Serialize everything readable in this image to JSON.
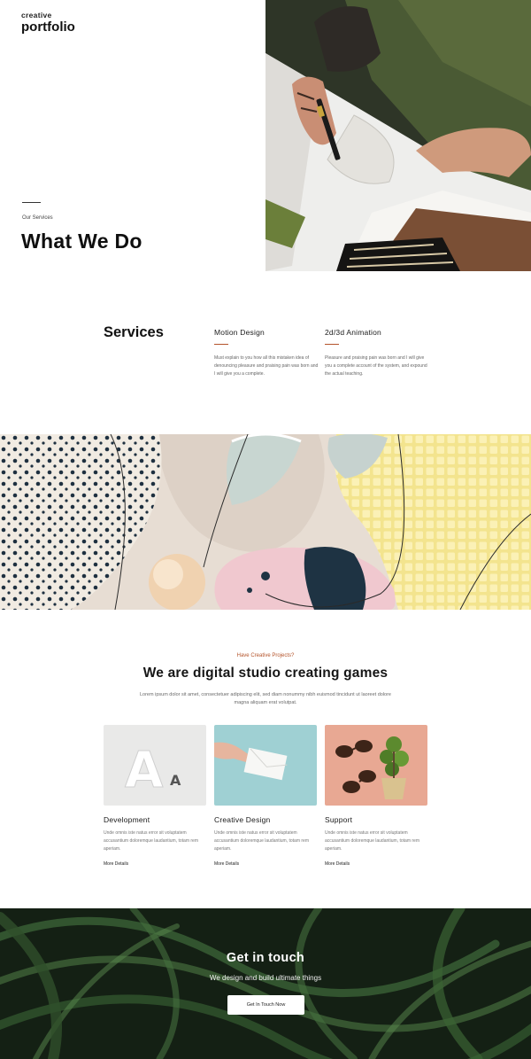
{
  "brand": {
    "top": "creative",
    "bottom": "portfolio"
  },
  "hero": {
    "eyebrow": "Our Services",
    "title": "What We Do",
    "image_icon": "designer-sketching-photo"
  },
  "services": {
    "title": "Services",
    "items": [
      {
        "name": "Motion Design",
        "text": "Must explain to you how all this mistaken idea of denouncing pleasure and praising pain was born and I will give you a complete."
      },
      {
        "name": "2d/3d Animation",
        "text": "Pleasure and praising pain was born and I will give you a complete account of the system, and expound the actual teaching."
      }
    ]
  },
  "banner": {
    "image_icon": "abstract-shapes-photo"
  },
  "studio": {
    "eyebrow": "Have Creative Projects?",
    "title": "We are digital studio creating games",
    "description": "Lorem ipsum dolor sit amet, consectetuer adipiscing elit, sed diam nonummy nibh euismod tincidunt ut laoreet dolore magna aliquam erat volutpat.",
    "cards": [
      {
        "title": "Development",
        "text": "Unde omnis iste natus error sit voluptatem accusantium doloremque laudantium, totam rem aperiam.",
        "link": "More Details",
        "image_icon": "typography-letters-photo"
      },
      {
        "title": "Creative Design",
        "text": "Unde omnis iste natus error sit voluptatem accusantium doloremque laudantium, totam rem aperiam.",
        "link": "More Details",
        "image_icon": "envelope-hand-photo"
      },
      {
        "title": "Support",
        "text": "Unde omnis iste natus error sit voluptatem accusantium doloremque laudantium, totam rem aperiam.",
        "link": "More Details",
        "image_icon": "sunglasses-plant-photo"
      }
    ]
  },
  "contact": {
    "title": "Get in touch",
    "subtitle": "We design and build ultimate things",
    "button": "Get In Touch Now",
    "image_icon": "green-leaves-photo"
  },
  "colors": {
    "accent": "#b4532a",
    "text": "#1c1c1c",
    "contact_bg": "#172416"
  }
}
